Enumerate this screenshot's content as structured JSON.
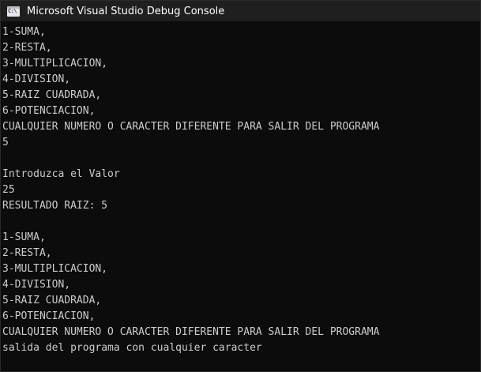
{
  "window": {
    "title": "Microsoft Visual Studio Debug Console",
    "icon": "console-app-icon",
    "icon_glyph": "C:\\"
  },
  "colors": {
    "background": "#0c0c0c",
    "text": "#cccccc",
    "titlebar": "#1f1f1f"
  },
  "console": {
    "lines": [
      "1-SUMA,",
      "2-RESTA,",
      "3-MULTIPLICACION,",
      "4-DIVISION,",
      "5-RAIZ CUADRADA,",
      "6-POTENCIACION,",
      "CUALQUIER NUMERO O CARACTER DIFERENTE PARA SALIR DEL PROGRAMA",
      "5",
      "",
      "Introduzca el Valor",
      "25",
      "RESULTADO RAIZ: 5",
      "",
      "1-SUMA,",
      "2-RESTA,",
      "3-MULTIPLICACION,",
      "4-DIVISION,",
      "5-RAIZ CUADRADA,",
      "6-POTENCIACION,",
      "CUALQUIER NUMERO O CARACTER DIFERENTE PARA SALIR DEL PROGRAMA",
      "salida del programa con cualquier caracter"
    ]
  }
}
